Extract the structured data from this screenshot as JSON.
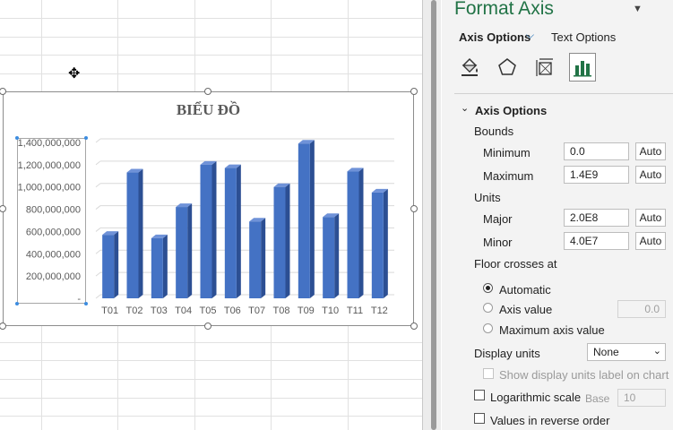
{
  "chart": {
    "title": "BIỂU ĐỒ"
  },
  "chart_data": {
    "type": "bar",
    "title": "BIỂU ĐỒ",
    "categories": [
      "T01",
      "T02",
      "T03",
      "T04",
      "T05",
      "T06",
      "T07",
      "T08",
      "T09",
      "T10",
      "T11",
      "T12"
    ],
    "values": [
      570000000,
      1130000000,
      540000000,
      820000000,
      1200000000,
      1170000000,
      690000000,
      1000000000,
      1390000000,
      730000000,
      1140000000,
      950000000
    ],
    "ylim": [
      0,
      1400000000
    ],
    "yticks": [
      "-",
      "200,000,000",
      "400,000,000",
      "600,000,000",
      "800,000,000",
      "1,000,000,000",
      "1,200,000,000",
      "1,400,000,000"
    ],
    "bar_color": "#4472c4",
    "grid": true,
    "legend": "none"
  },
  "panel": {
    "title": "Format Axis",
    "tabs": {
      "axis_options": "Axis Options",
      "text_options": "Text Options"
    },
    "icons": [
      "fill-line-icon",
      "effects-pentagon-icon",
      "size-properties-icon",
      "axis-options-bars-icon"
    ],
    "section_title": "Axis Options",
    "bounds": {
      "heading": "Bounds",
      "minimum_label": "Minimum",
      "minimum_value": "0.0",
      "maximum_label": "Maximum",
      "maximum_value": "1.4E9",
      "auto_label": "Auto"
    },
    "units": {
      "heading": "Units",
      "major_label": "Major",
      "major_value": "2.0E8",
      "minor_label": "Minor",
      "minor_value": "4.0E7"
    },
    "floor": {
      "heading": "Floor crosses at",
      "automatic": "Automatic",
      "axis_value": "Axis value",
      "axis_value_input": "0.0",
      "maximum_axis_value": "Maximum axis value"
    },
    "display_units": {
      "label": "Display units",
      "selected": "None",
      "show_label": "Show display units label on chart"
    },
    "log_scale": {
      "label": "Logarithmic scale",
      "base_label": "Base",
      "base_value": "10"
    },
    "reverse_order": "Values in reverse order"
  }
}
